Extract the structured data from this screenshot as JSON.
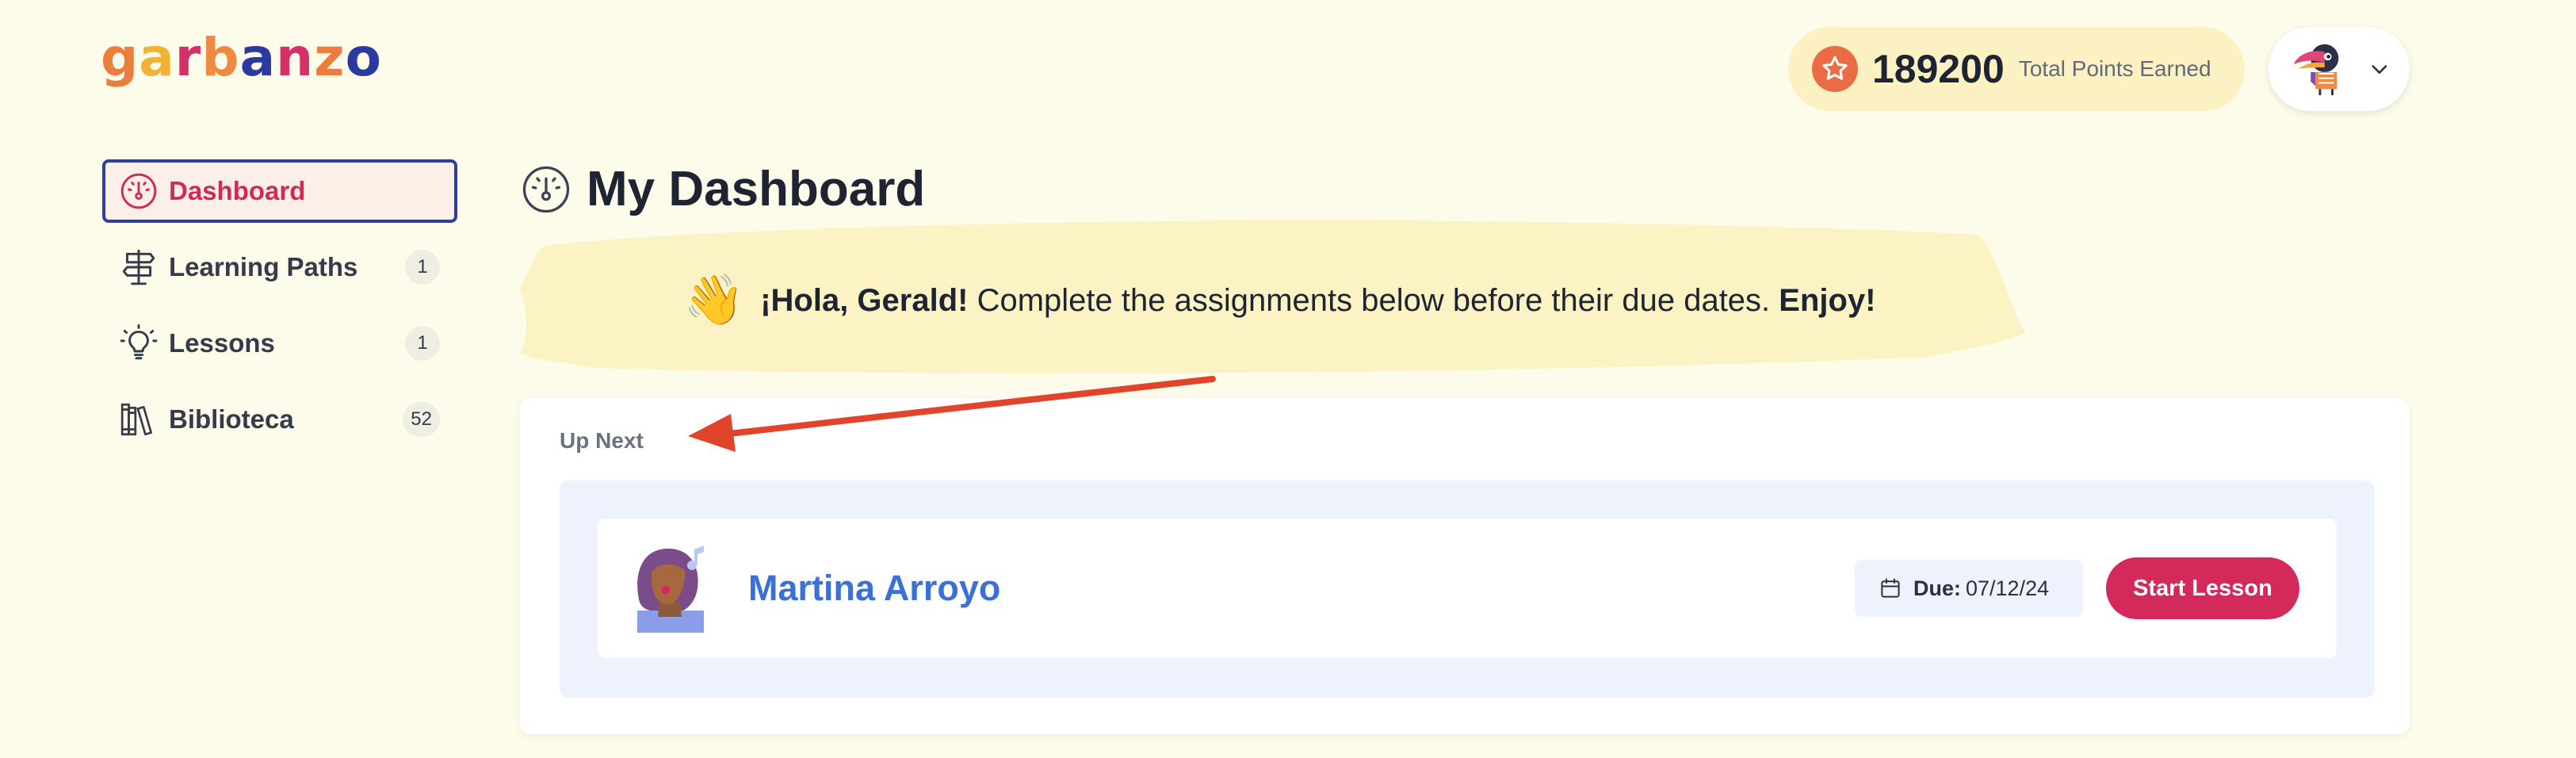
{
  "brand": {
    "letters": [
      {
        "char": "g",
        "color": "#ec7d3d"
      },
      {
        "char": "a",
        "color": "#f2b233"
      },
      {
        "char": "r",
        "color": "#d63167"
      },
      {
        "char": "b",
        "color": "#f08a43"
      },
      {
        "char": "a",
        "color": "#2a3aa0"
      },
      {
        "char": "n",
        "color": "#d63167"
      },
      {
        "char": "z",
        "color": "#ec7d3d"
      },
      {
        "char": "o",
        "color": "#2a3aa0"
      }
    ]
  },
  "header": {
    "points_icon": "star-icon",
    "points_value": "189200",
    "points_label": "Total Points Earned",
    "avatar_icon": "toucan-avatar-icon",
    "menu_icon": "chevron-down-icon"
  },
  "sidebar": {
    "items": [
      {
        "label": "Dashboard",
        "icon": "gauge-icon",
        "active": true,
        "badge": ""
      },
      {
        "label": "Learning Paths",
        "icon": "signpost-icon",
        "active": false,
        "badge": "1"
      },
      {
        "label": "Lessons",
        "icon": "lightbulb-icon",
        "active": false,
        "badge": "1"
      },
      {
        "label": "Biblioteca",
        "icon": "books-icon",
        "active": false,
        "badge": "52"
      }
    ]
  },
  "main": {
    "title": "My Dashboard",
    "title_icon": "gauge-icon",
    "greeting": {
      "emoji": "👋",
      "name_part": "¡Hola, Gerald!",
      "message": " Complete the assignments below before their due dates. ",
      "closing": "Enjoy!"
    },
    "up_next": {
      "label": "Up Next",
      "lesson": {
        "title": "Martina Arroyo",
        "thumbnail_icon": "singer-portrait-icon",
        "due_label": "Due:",
        "due_date": "07/12/24",
        "action_label": "Start Lesson"
      }
    }
  },
  "colors": {
    "background": "#fdfbea",
    "accent_pink": "#d42a5b",
    "active_border": "#2c3e9e",
    "link_blue": "#3a71d8",
    "arrow_red": "#e0452c"
  }
}
